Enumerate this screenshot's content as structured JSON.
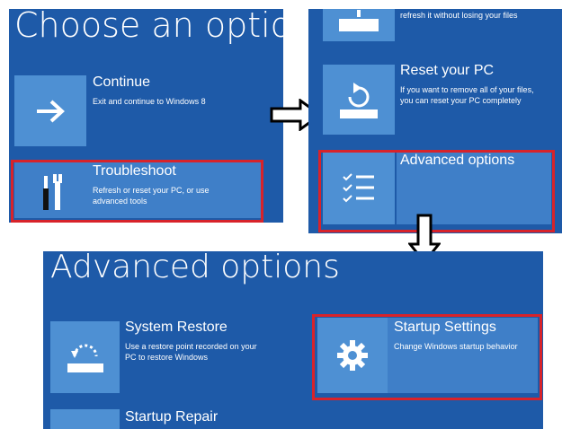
{
  "panel1": {
    "title": "Choose an option",
    "options": [
      {
        "title": "Continue",
        "desc": "Exit and continue to Windows 8"
      },
      {
        "title": "Troubleshoot",
        "desc": [
          "Refresh or reset your PC, or use",
          "advanced tools"
        ]
      }
    ]
  },
  "panel2": {
    "options": [
      {
        "desc": "refresh it without losing your files"
      },
      {
        "title": "Reset your PC",
        "desc": [
          "If you want to remove all of your files,",
          "you can reset your PC completely"
        ]
      },
      {
        "title": "Advanced options"
      }
    ]
  },
  "panel3": {
    "title": "Advanced options",
    "options": [
      {
        "title": "System Restore",
        "desc": [
          "Use a restore point recorded on your",
          "PC to restore Windows"
        ]
      },
      {
        "title": "Startup Settings",
        "desc": "Change Windows startup behavior"
      },
      {
        "title": "Startup Repair"
      }
    ]
  },
  "colors": {
    "panel_bg": "#1e5aa8",
    "tile_bg": "#4e90d3",
    "highlight": "#d8232a"
  },
  "icons": [
    "arrow-right-icon",
    "wrench-screwdriver-icon",
    "drive-icon",
    "reset-icon",
    "checklist-icon",
    "restore-icon",
    "gear-icon",
    "repair-icon",
    "outline-arrow-right-icon",
    "outline-arrow-down-icon"
  ]
}
